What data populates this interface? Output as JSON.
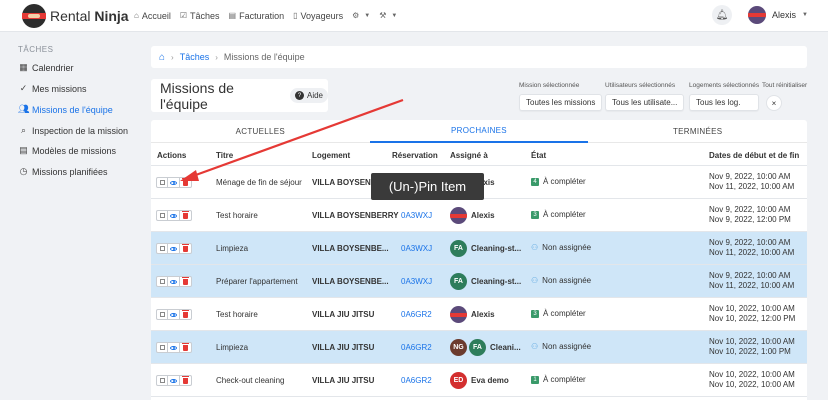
{
  "brand": {
    "name_part1": "Rental",
    "name_part2": "Ninja"
  },
  "nav": {
    "items": [
      {
        "label": "Accueil",
        "icon": "home-icon"
      },
      {
        "label": "Tâches",
        "icon": "check-square-icon"
      },
      {
        "label": "Facturation",
        "icon": "invoice-icon"
      },
      {
        "label": "Voyageurs",
        "icon": "phone-icon"
      }
    ],
    "user_name": "Alexis"
  },
  "sidebar": {
    "title": "TÂCHES",
    "items": [
      {
        "label": "Calendrier",
        "icon": "calendar-icon"
      },
      {
        "label": "Mes missions",
        "icon": "checks-icon"
      },
      {
        "label": "Missions de l'équipe",
        "icon": "users-icon"
      },
      {
        "label": "Inspection de la mission",
        "icon": "search-icon"
      },
      {
        "label": "Modèles de missions",
        "icon": "template-icon"
      },
      {
        "label": "Missions planifiées",
        "icon": "clock-icon"
      }
    ]
  },
  "breadcrumb": {
    "link": "Tâches",
    "current": "Missions de l'équipe"
  },
  "header": {
    "title": "Missions de l'équipe",
    "help_label": "Aide"
  },
  "filters": {
    "mission": {
      "label": "Mission sélectionnée",
      "value": "Toutes les missions"
    },
    "users": {
      "label": "Utilisateurs sélectionnés",
      "value": "Tous les utilisate..."
    },
    "logements": {
      "label": "Logements sélectionnés",
      "value": "Tous les log."
    },
    "reset": {
      "label": "Tout réinitialiser",
      "value": "×"
    }
  },
  "tabs": [
    {
      "label": "ACTUELLES"
    },
    {
      "label": "PROCHAINES"
    },
    {
      "label": "TERMINÉES"
    }
  ],
  "table": {
    "headers": [
      "Actions",
      "Titre",
      "Logement",
      "Réservation",
      "Assigné à",
      "État",
      "Dates de début et de fin"
    ],
    "rows": [
      {
        "title": "Ménage de fin de séjour",
        "logement": "VILLA BOYSENBERRY",
        "res": "",
        "assignees": [
          {
            "type": "ninja",
            "initials": ""
          }
        ],
        "name": "Alexis",
        "state_icon": "4",
        "state": "À compléter",
        "start": "Nov 9, 2022, 10:00 AM",
        "end": "Nov 11, 2022, 10:00 AM",
        "pinned": false
      },
      {
        "title": "Test horaire",
        "logement": "VILLA BOYSENBERRY",
        "res": "0A3WXJ",
        "assignees": [
          {
            "type": "ninja",
            "initials": ""
          }
        ],
        "name": "Alexis",
        "state_icon": "3",
        "state": "À compléter",
        "start": "Nov 9, 2022, 10:00 AM",
        "end": "Nov 9, 2022, 12:00 PM",
        "pinned": false
      },
      {
        "title": "Limpieza",
        "logement": "VILLA BOYSENBE...",
        "res": "0A3WXJ",
        "assignees": [
          {
            "type": "fa",
            "initials": "FA"
          }
        ],
        "name": "Cleaning-st...",
        "state_icon": "",
        "state": "Non assignée",
        "start": "Nov 9, 2022, 10:00 AM",
        "end": "Nov 11, 2022, 10:00 AM",
        "pinned": true
      },
      {
        "title": "Préparer l'appartement",
        "logement": "VILLA BOYSENBE...",
        "res": "0A3WXJ",
        "assignees": [
          {
            "type": "fa",
            "initials": "FA"
          }
        ],
        "name": "Cleaning-st...",
        "state_icon": "",
        "state": "Non assignée",
        "start": "Nov 9, 2022, 10:00 AM",
        "end": "Nov 11, 2022, 10:00 AM",
        "pinned": true
      },
      {
        "title": "Test horaire",
        "logement": "VILLA JIU JITSU",
        "res": "0A6GR2",
        "assignees": [
          {
            "type": "ninja",
            "initials": ""
          }
        ],
        "name": "Alexis",
        "state_icon": "3",
        "state": "À compléter",
        "start": "Nov 10, 2022, 10:00 AM",
        "end": "Nov 10, 2022, 12:00 PM",
        "pinned": false
      },
      {
        "title": "Limpieza",
        "logement": "VILLA JIU JITSU",
        "res": "0A6GR2",
        "assignees": [
          {
            "type": "ng",
            "initials": "NG"
          },
          {
            "type": "fa",
            "initials": "FA"
          }
        ],
        "name": "Cleani...",
        "state_icon": "",
        "state": "Non assignée",
        "start": "Nov 10, 2022, 10:00 AM",
        "end": "Nov 10, 2022, 1:00 PM",
        "pinned": true
      },
      {
        "title": "Check-out cleaning",
        "logement": "VILLA JIU JITSU",
        "res": "0A6GR2",
        "assignees": [
          {
            "type": "ed",
            "initials": "ED"
          }
        ],
        "name": "Eva demo",
        "state_icon": "1",
        "state": "À compléter",
        "start": "Nov 10, 2022, 10:00 AM",
        "end": "Nov 10, 2022, 10:00 AM",
        "pinned": false
      }
    ]
  },
  "tooltip": {
    "text": "(Un-)Pin Item"
  },
  "colors": {
    "accent": "#1a73e8",
    "pinned_row": "#cfe6f8",
    "arrow": "#e53935",
    "state_green": "#3a9a6a"
  }
}
